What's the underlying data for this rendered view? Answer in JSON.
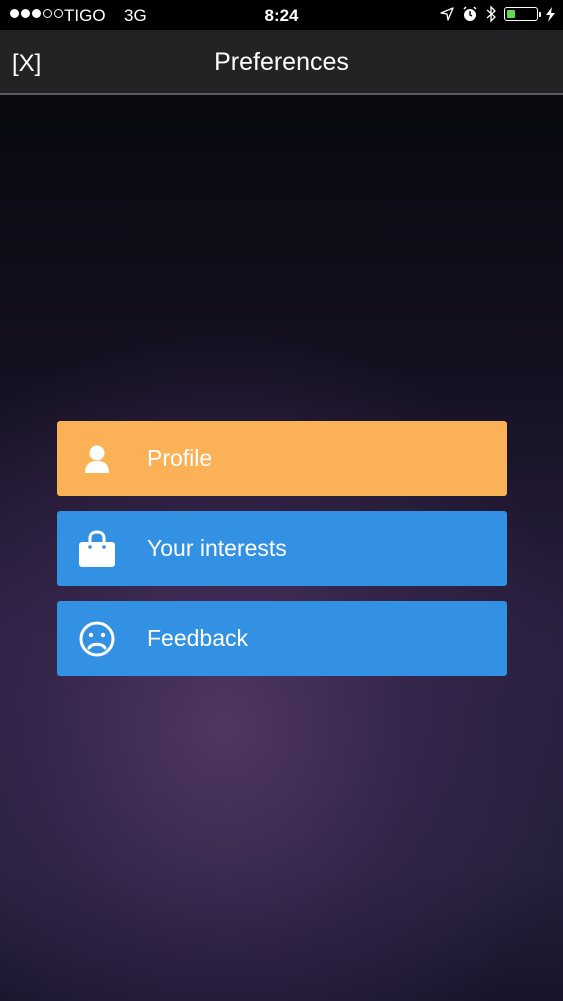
{
  "status_bar": {
    "carrier": "TIGO",
    "network": "3G",
    "time": "8:24",
    "signal_bars_filled": 3,
    "signal_bars_total": 5,
    "battery_level_percent": 25,
    "icons": [
      "location-arrow-icon",
      "alarm-icon",
      "bluetooth-icon",
      "battery-icon",
      "charging-bolt-icon"
    ]
  },
  "nav": {
    "close_label": "[X]",
    "title": "Preferences"
  },
  "menu": {
    "items": [
      {
        "label": "Profile",
        "icon": "user-icon",
        "color": "#fbb256"
      },
      {
        "label": "Your interests",
        "icon": "shopping-bag-icon",
        "color": "#3391e3"
      },
      {
        "label": "Feedback",
        "icon": "sad-face-icon",
        "color": "#3391e3"
      }
    ]
  }
}
